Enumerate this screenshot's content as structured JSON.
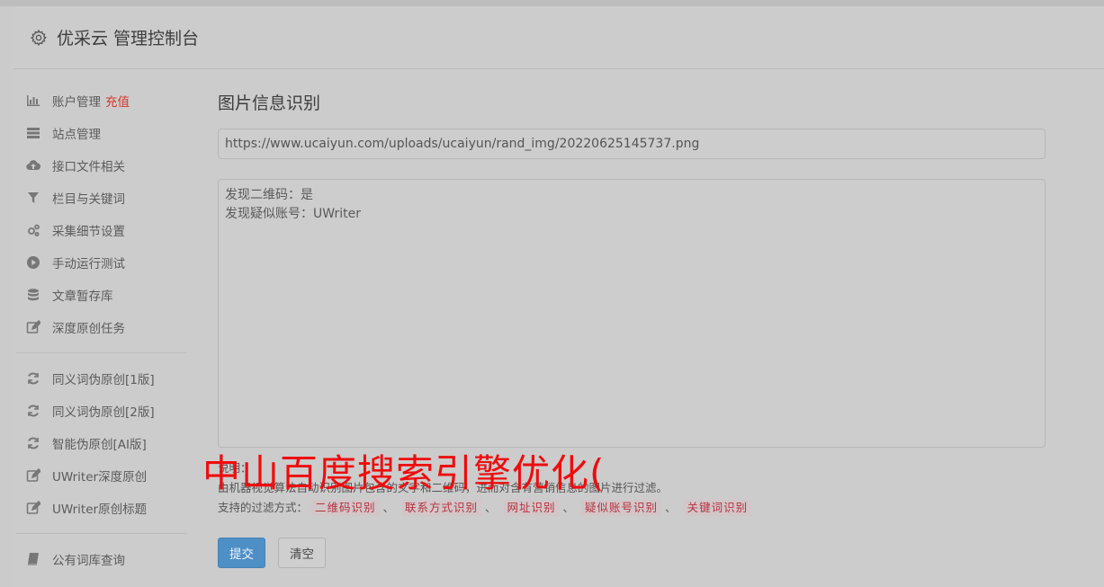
{
  "header": {
    "title": "优采云 管理控制台"
  },
  "sidebar": {
    "group1": [
      {
        "label": "账户管理",
        "extra": "充值",
        "icon": "bar-chart-icon"
      },
      {
        "label": "站点管理",
        "icon": "server-icon"
      },
      {
        "label": "接口文件相关",
        "icon": "cloud-upload-icon"
      },
      {
        "label": "栏目与关键词",
        "icon": "filter-icon"
      },
      {
        "label": "采集细节设置",
        "icon": "cogs-icon"
      },
      {
        "label": "手动运行测试",
        "icon": "play-circle-icon"
      },
      {
        "label": "文章暂存库",
        "icon": "database-icon"
      },
      {
        "label": "深度原创任务",
        "icon": "edit-icon"
      }
    ],
    "group2": [
      {
        "label": "同义词伪原创[1版]",
        "icon": "refresh-icon"
      },
      {
        "label": "同义词伪原创[2版]",
        "icon": "refresh-icon"
      },
      {
        "label": "智能伪原创[AI版]",
        "icon": "refresh-icon"
      },
      {
        "label": "UWriter深度原创",
        "icon": "edit-icon"
      },
      {
        "label": "UWriter原创标题",
        "icon": "edit-icon"
      }
    ],
    "group3": [
      {
        "label": "公有词库查询",
        "icon": "book-icon"
      }
    ]
  },
  "main": {
    "heading": "图片信息识别",
    "url_value": "https://www.ucaiyun.com/uploads/ucaiyun/rand_img/20220625145737.png",
    "result_lines": [
      "发现二维码：是",
      "发现疑似账号：UWriter"
    ],
    "desc_label": "说明：",
    "desc_text": "由机器视觉算法自动识别图片包含的文字和二维码，进而对含有营销信息的图片进行过滤。",
    "filter_label": "支持的过滤方式：",
    "filters": [
      "二维码识别",
      "联系方式识别",
      "网址识别",
      "疑似账号识别",
      "关键词识别"
    ],
    "filter_sep": "、",
    "submit_label": "提交",
    "clear_label": "清空"
  },
  "watermark": "中山百度搜索引擎优化(",
  "colors": {
    "accent": "#4e8fc5",
    "recharge": "#d23a2e",
    "tag_text": "#b5323f",
    "watermark": "#ee0d0d"
  }
}
